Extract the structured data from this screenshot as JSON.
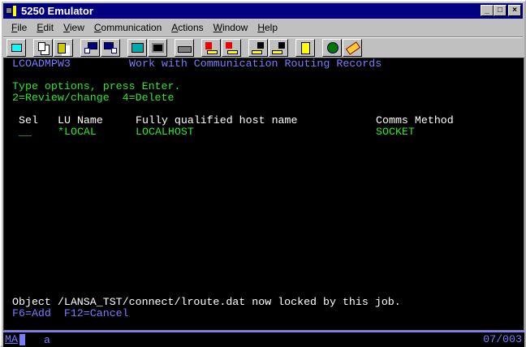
{
  "window": {
    "title": "5250 Emulator",
    "minimize": "_",
    "maximize": "□",
    "close": "×"
  },
  "menu": [
    {
      "u": "F",
      "rest": "ile"
    },
    {
      "u": "E",
      "rest": "dit"
    },
    {
      "u": "V",
      "rest": "iew"
    },
    {
      "u": "C",
      "rest": "ommunication"
    },
    {
      "u": "A",
      "rest": "ctions"
    },
    {
      "u": "W",
      "rest": "indow"
    },
    {
      "u": "H",
      "rest": "elp"
    }
  ],
  "toolbar": [
    "print-screen-icon",
    "copy-icon",
    "paste-icon",
    "send-file-icon",
    "receive-file-icon",
    "display-setup-icon",
    "color-map-icon",
    "keyboard-icon",
    "record-macro-icon",
    "stop-record-icon",
    "play-macro-icon",
    "stop-macro-icon",
    "clipboard-icon",
    "web-help-icon",
    "help-icon"
  ],
  "screen": {
    "program": "LCOADMPW3",
    "heading": "Work with Communication Routing Records",
    "instructions": "Type options, press Enter.",
    "options": "2=Review/change  4=Delete",
    "columns": {
      "sel": "Sel",
      "lu": "LU Name",
      "host": "Fully qualified host name",
      "method": "Comms Method"
    },
    "rows": [
      {
        "sel": "__",
        "lu": "*LOCAL",
        "host": "LOCALHOST",
        "method": "SOCKET"
      }
    ],
    "message": "Object /LANSA_TST/connect/lroute.dat now locked by this job.",
    "fkeys": "F6=Add  F12=Cancel"
  },
  "status": {
    "mode": "MA",
    "indicator": "a",
    "cursor": "07/003"
  },
  "colors": {
    "green": "#2ee62e",
    "blue": "#7b7bff",
    "white": "#ffffff",
    "titlebar": "#000080"
  }
}
